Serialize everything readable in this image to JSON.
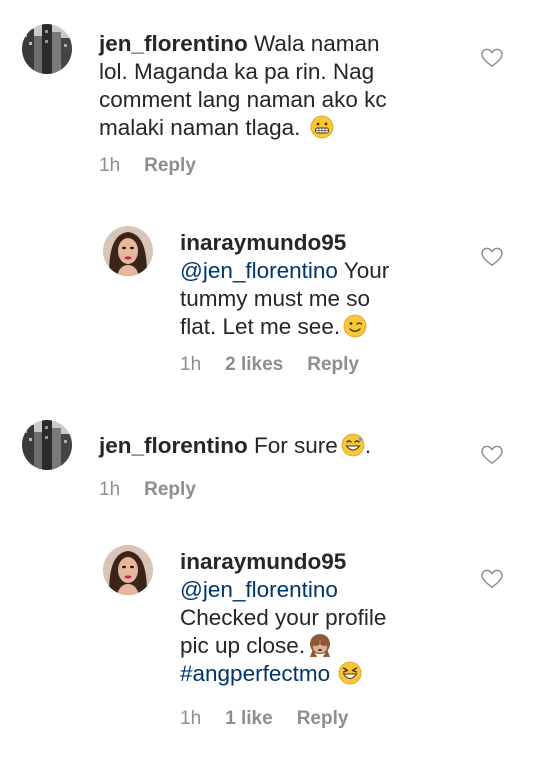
{
  "comments": [
    {
      "username": "jen_florentino",
      "text": "Wala naman lol. Maganda ka pa rin. Nag comment lang naman ako kc malaki naman tlaga.",
      "time": "1h",
      "likes": "",
      "reply_label": "Reply",
      "emoji": "grimacing-face-emoji"
    },
    {
      "username": "inaraymundo95",
      "mention": "@jen_florentino",
      "text": "Your tummy must me so flat. Let me see.",
      "time": "1h",
      "likes": "2 likes",
      "reply_label": "Reply",
      "emoji": "winking-face-emoji"
    },
    {
      "username": "jen_florentino",
      "text": "For sure",
      "text_after": ".",
      "time": "1h",
      "likes": "",
      "reply_label": "Reply",
      "emoji": "grinning-face-with-sweat-emoji"
    },
    {
      "username": "inaraymundo95",
      "mention": "@jen_florentino",
      "text": "Checked your profile pic up close.",
      "hashtag": "#angperfectmo",
      "time": "1h",
      "likes": "1 like",
      "reply_label": "Reply",
      "emoji": "see-no-evil-monkey-emoji",
      "emoji2": "laughing-squinting-face-emoji"
    }
  ],
  "colors": {
    "text": "#262626",
    "meta": "#8e8e8e",
    "link": "#003569"
  }
}
